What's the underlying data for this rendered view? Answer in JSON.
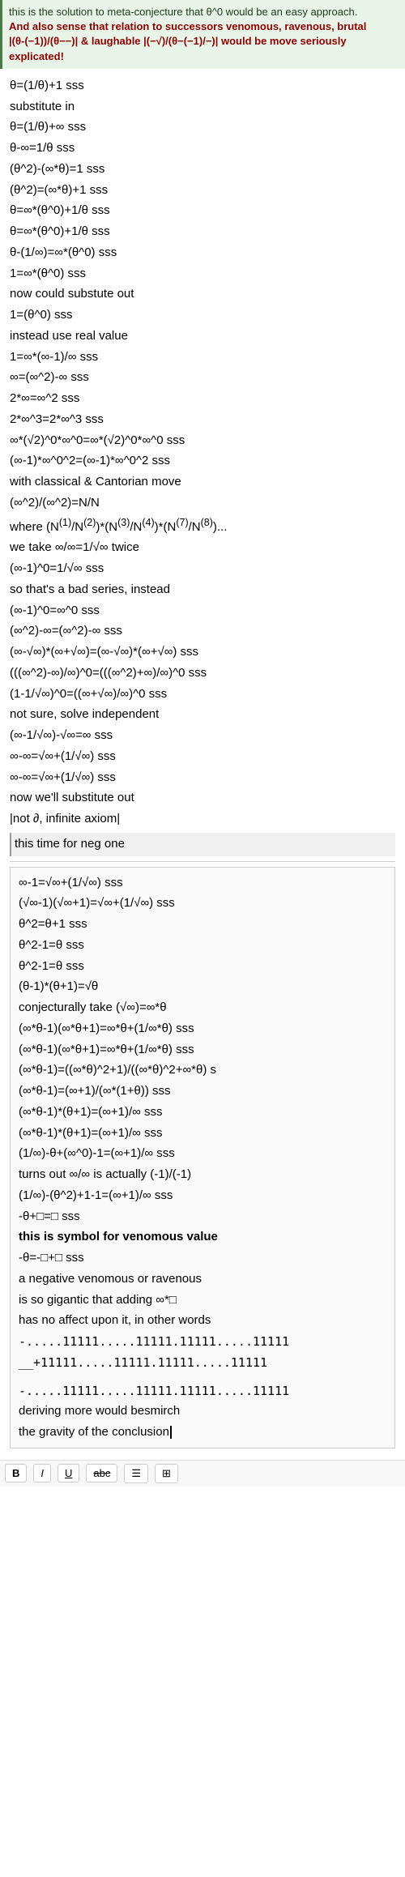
{
  "banner": {
    "line1": "this is the solution to meta-conjecture that θ^0 would be an easy approach.",
    "line2": "And also sense that relation to successors venomous, ravenous, brutal",
    "line3": "|(θ-(−1))/(θ−−)| & laughable |(−√)/(θ−(−1)/−)| would be move seriously explicated!"
  },
  "content": {
    "lines": [
      "θ=(1/θ)+1 sss",
      "substitute in",
      "θ=(1/θ)+∞ sss",
      "θ-∞=1/θ sss",
      "(θ^2)-(∞*θ)=1 sss",
      "(θ^2)=(∞*θ)+1 sss",
      "θ=∞*(θ^0)+1/θ sss",
      "θ=∞*(θ^0)+1/θ sss",
      "θ-(1/∞)=∞*(θ^0) sss",
      "1=∞*(θ^0) sss",
      "now could substute out",
      "1=(θ^0) sss",
      "instead use real value",
      "1=∞*(∞-1)/∞ sss",
      "∞=(∞^2)-∞ sss",
      "2*∞=∞^2 sss",
      "2*∞^3=2*∞^3 sss",
      "∞*(√2)^0*∞^0=∞*(√2)^0*∞^0 sss",
      "(∞-1)*∞^0^2=(∞-1)*∞^0^2 sss",
      "with classical & Cantorian move",
      "(∞^2)/(∞^2)=N/N",
      "where (N⁽¹⁾/N⁽²⁾)*(N⁽³⁾/N⁽⁴⁾)*(N⁽⁷⁾/N⁽⁸⁾)...",
      "we take ∞/∞=1/√∞ twice",
      "(∞-1)^0=1/√∞ sss",
      "so that's a bad series, instead",
      "(∞-1)^0=∞^0 sss",
      "(∞^2)-∞=(∞^2)-∞ sss",
      "(∞-√∞)*(∞+√∞)=(∞-√∞)*(∞+√∞) sss",
      "(((∞^2)-∞)/∞)^0=(((∞^2)+∞)/∞)^0 sss",
      "(1-1/√∞)^0=((∞+√∞)/∞)^0 sss",
      "not sure, solve independent",
      "(∞-1/√∞)-√∞=∞ sss",
      "∞-∞=√∞+(1/√∞) sss",
      "∞-∞=√∞+(1/√∞) sss",
      "now we'll substitute out",
      "|not ∂, infinite axiom|",
      "this time for neg one"
    ],
    "section2_lines": [
      "∞-1=√∞+(1/√∞) sss",
      "(√∞-1)(√∞+1)=√∞+(1/√∞) sss",
      "θ^2=θ+1 sss",
      "θ^2-1=θ sss",
      "θ^2-1=θ sss",
      "(θ-1)*(θ+1)=√θ",
      "conjecturally take (√∞)=∞*θ",
      "(∞*θ-1)(∞*θ+1)=∞*θ+(1/∞*θ) sss",
      "(∞*θ-1)(∞*θ+1)=∞*θ+(1/∞*θ) sss",
      "(∞*θ-1)=((∞*θ)^2+1)/((∞*θ)^2+∞*θ) s",
      "(∞*θ-1)=(∞+1)/(∞*(1+θ)) sss",
      "(∞*θ-1)*(θ+1)=(∞+1)/∞ sss",
      "(∞*θ-1)*(θ+1)=(∞+1)/∞ sss",
      "(1/∞)-θ+(∞^0)-1=(∞+1)/∞ sss",
      "turns out ∞/∞ is actually (-1)/(-1)",
      "(1/∞)-(θ^2)+1-1=(∞+1)/∞ sss",
      "-θ+□=□ sss",
      "this is symbol for venomous value",
      "-θ=-□+□ sss",
      "a negative venomous or ravenous",
      "is so gigantic that adding ∞*□",
      "has no affect upon it, in other words",
      "-.....11111.....11111.11111.....11111",
      "__+11111.....11111.11111.....11111",
      "",
      "-.....11111.....11111.11111.....11111",
      "deriving more would besmirch",
      "the gravity of the conclusion"
    ]
  },
  "toolbar": {
    "btn1": "B",
    "btn2": "I",
    "btn3": "underline_label",
    "btn4": "abc",
    "btn5": "list_icon",
    "btn6": "grid_icon"
  }
}
